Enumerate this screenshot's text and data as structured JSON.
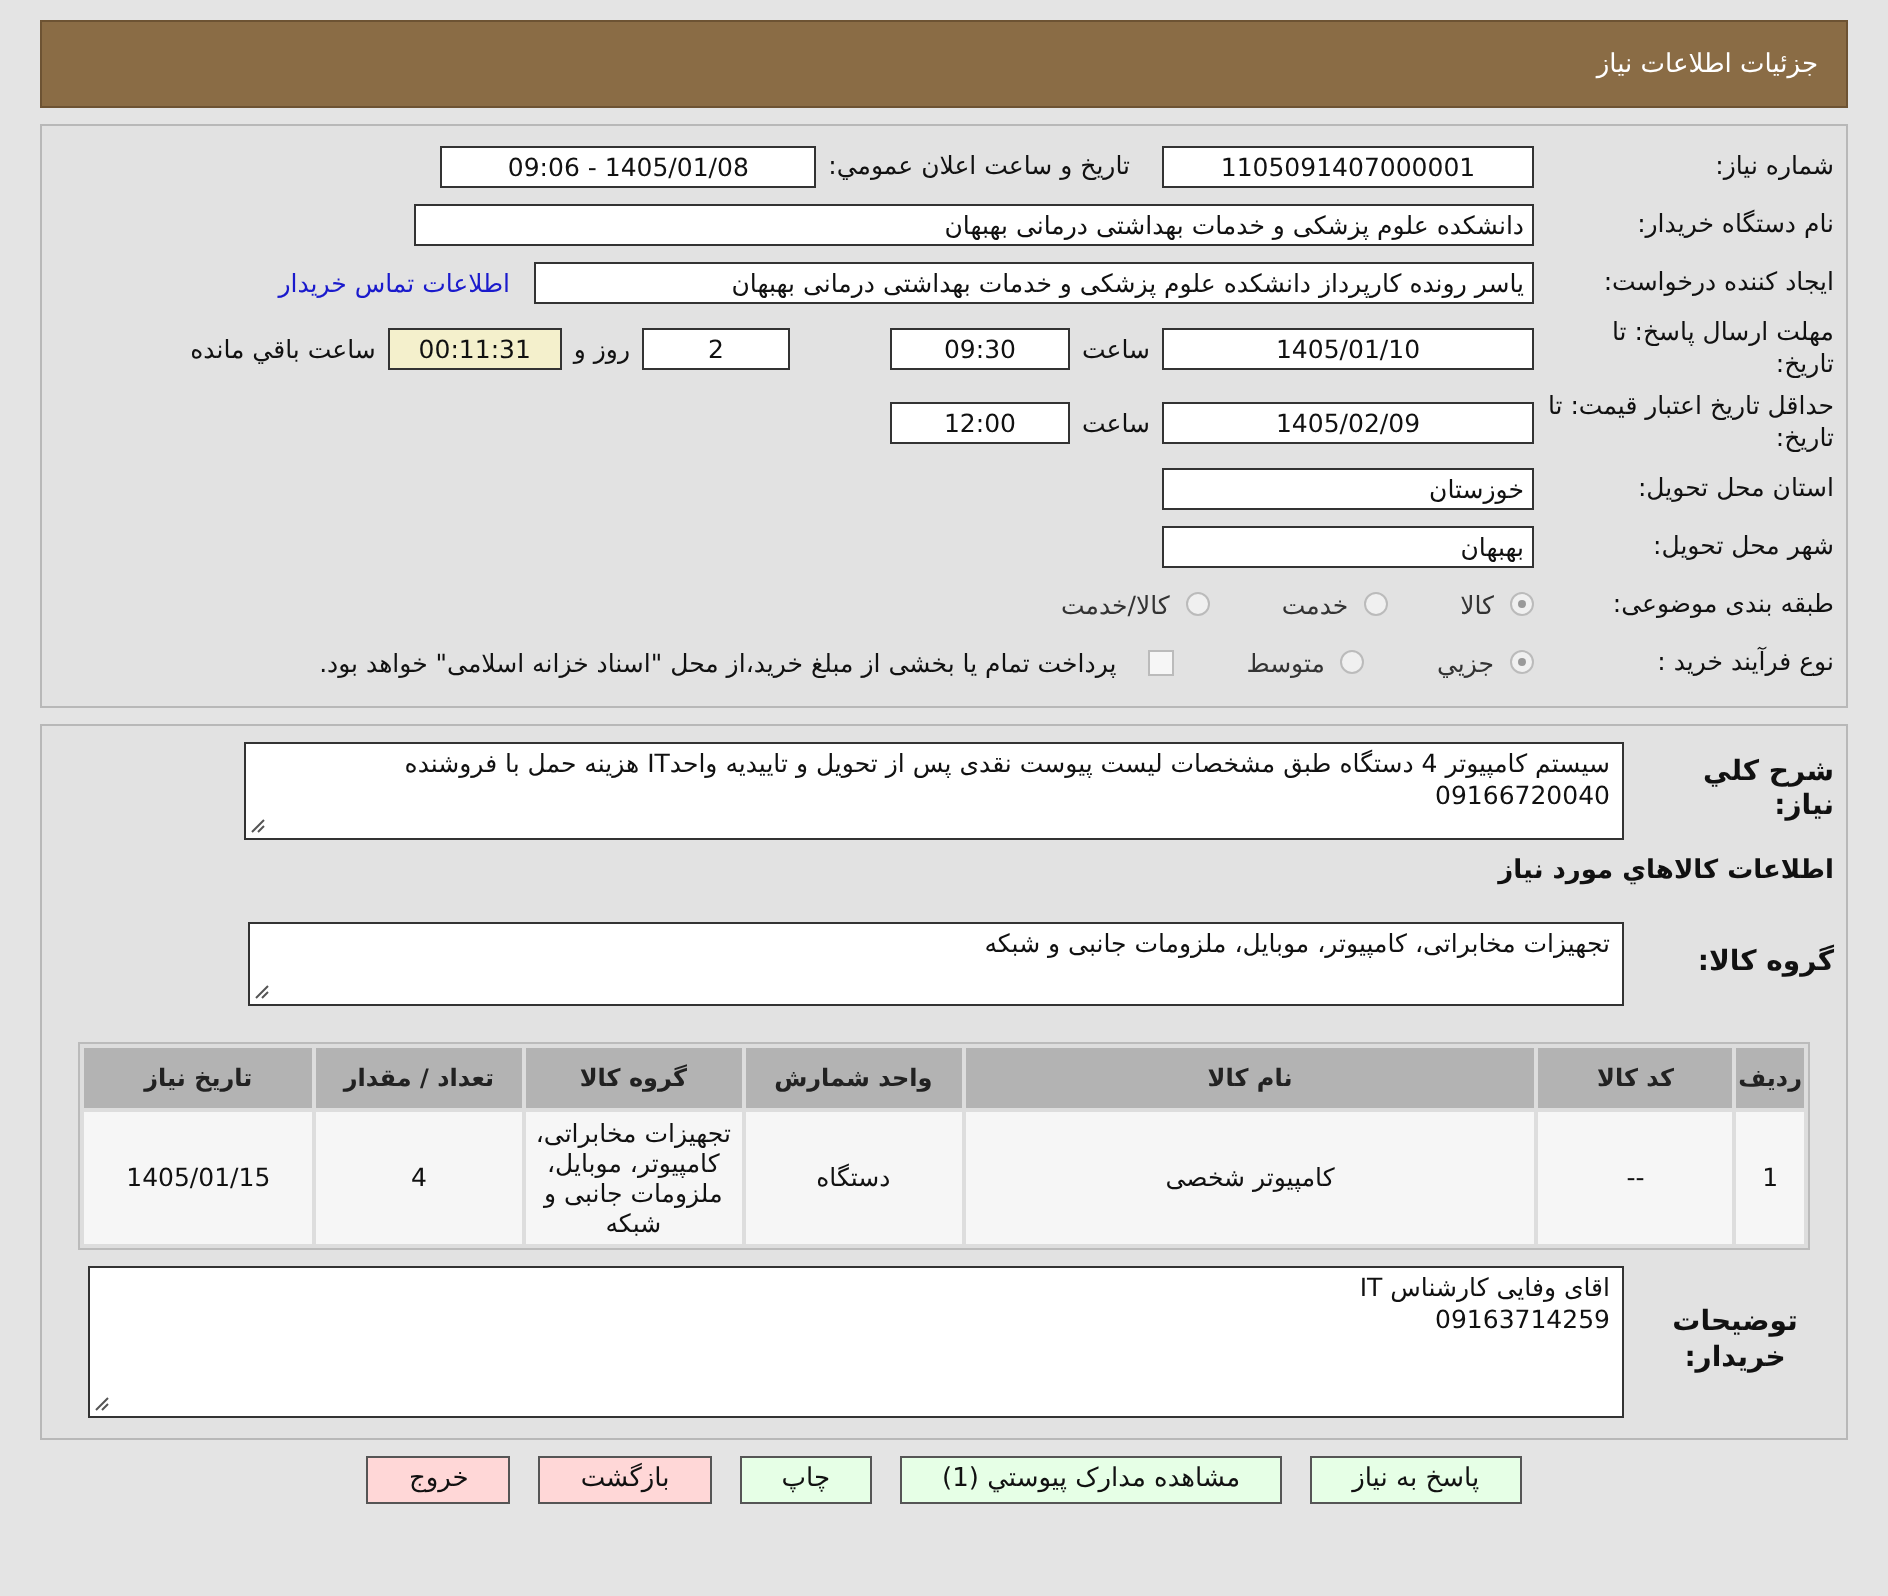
{
  "header": {
    "title": "جزئیات اطلاعات نیاز"
  },
  "info": {
    "need_number": {
      "label": "شماره نیاز:",
      "value": "1105091407000001"
    },
    "announce": {
      "label": "تاریخ و ساعت اعلان عمومي:",
      "value": "1405/01/08 - 09:06"
    },
    "buyer": {
      "label": "نام دستگاه خریدار:",
      "value": "دانشکده علوم پزشکی و خدمات بهداشتی  درمانی بهبهان"
    },
    "creator": {
      "label": "ایجاد کننده درخواست:",
      "value": "یاسر رونده کارپرداز دانشکده علوم پزشکی و خدمات بهداشتی  درمانی بهبهان",
      "link": "اطلاعات تماس خریدار"
    },
    "deadline": {
      "label": "مهلت ارسال پاسخ: تا تاریخ:",
      "date": "1405/01/10",
      "time_label": "ساعت",
      "time": "09:30",
      "days": "2",
      "days_label": "روز و",
      "remaining": "00:11:31",
      "remaining_label": "ساعت باقي مانده"
    },
    "validity": {
      "label": "حداقل تاریخ اعتبار قیمت: تا تاریخ:",
      "date": "1405/02/09",
      "time_label": "ساعت",
      "time": "12:00"
    },
    "province": {
      "label": "استان محل تحویل:",
      "value": "خوزستان"
    },
    "city": {
      "label": "شهر محل تحویل:",
      "value": "بهبهان"
    },
    "category": {
      "label": "طبقه بندی موضوعی:",
      "options": [
        {
          "label": "كالا",
          "selected": true
        },
        {
          "label": "خدمت",
          "selected": false
        },
        {
          "label": "كالا/خدمت",
          "selected": false
        }
      ]
    },
    "process": {
      "label": "نوع فرآیند خرید :",
      "options": [
        {
          "label": "جزيي",
          "selected": true
        },
        {
          "label": "متوسط",
          "selected": false
        }
      ],
      "treasury": {
        "checked": false,
        "text": "پرداخت تمام یا بخشی از مبلغ خرید،از محل \"اسناد خزانه اسلامی\" خواهد بود."
      }
    }
  },
  "details": {
    "description": {
      "label": "شرح كلي نياز:",
      "value": "سیستم کامپیوتر 4 دستگاه طبق مشخصات  لیست پیوست نقدی پس از تحویل و تاییدیه واحدIT هزینه حمل با فروشنده 09166720040"
    },
    "goods_heading": "اطلاعات كالاهاي مورد نياز",
    "goods_group": {
      "label": "گروه کالا:",
      "value": "تجهیزات مخابراتی، کامپیوتر، موبایل، ملزومات جانبی و شبکه"
    },
    "table": {
      "columns": [
        "رديف",
        "کد کالا",
        "نام کالا",
        "واحد شمارش",
        "گروه کالا",
        "تعداد / مقدار",
        "تاریخ نیاز"
      ],
      "rows": [
        [
          "1",
          "--",
          "کامپیوتر شخصی",
          "دستگاه",
          "تجهیزات مخابراتی، کامپیوتر، موبایل، ملزومات جانبی و شبکه",
          "4",
          "1405/01/15"
        ]
      ]
    },
    "notes": {
      "label": "توضیحات خریدار:",
      "lines": [
        "اقای وفایی کارشناس IT",
        "09163714259"
      ]
    }
  },
  "buttons": [
    {
      "label": "پاسخ به نیاز",
      "color": "#e6ffe6"
    },
    {
      "label": "مشاهده مدارک پیوستي (1)",
      "color": "#e6ffe6"
    },
    {
      "label": "چاپ",
      "color": "#e6ffe6"
    },
    {
      "label": "بازگشت",
      "color": "#ffd7d7"
    },
    {
      "label": "خروج",
      "color": "#ffd7d7"
    }
  ]
}
